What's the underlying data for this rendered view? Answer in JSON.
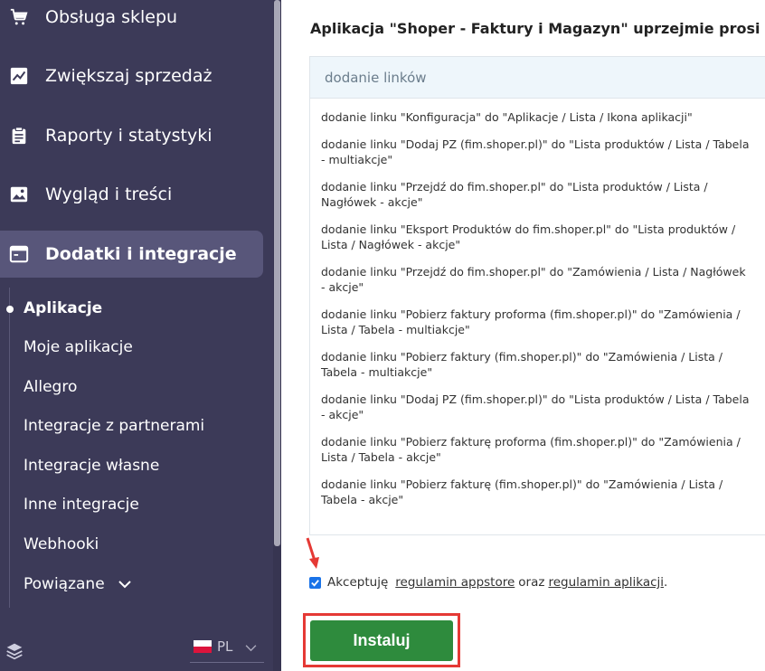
{
  "sidebar": {
    "nav": [
      {
        "label": "Obsługa sklepu",
        "icon": "cart-icon"
      },
      {
        "label": "Zwiększaj sprzedaż",
        "icon": "trend-chart-icon"
      },
      {
        "label": "Raporty i statystyki",
        "icon": "clipboard-icon"
      },
      {
        "label": "Wygląd i treści",
        "icon": "image-icon"
      },
      {
        "label": "Dodatki i integracje",
        "icon": "window-icon",
        "active": true
      }
    ],
    "subnav": [
      {
        "label": "Aplikacje",
        "active": true
      },
      {
        "label": "Moje aplikacje"
      },
      {
        "label": "Allegro"
      },
      {
        "label": "Integracje z partnerami"
      },
      {
        "label": "Integracje własne"
      },
      {
        "label": "Inne integracje"
      },
      {
        "label": "Webhooki"
      },
      {
        "label": "Powiązane"
      }
    ],
    "language": "PL"
  },
  "main": {
    "title": "Aplikacja \"Shoper - Faktury i Magazyn\" uprzejmie prosi o",
    "permissions_header": "dodanie linków",
    "permissions": [
      "dodanie linku \"Konfiguracja\" do \"Aplikacje / Lista / Ikona aplikacji\"",
      "dodanie linku \"Dodaj PZ (fim.shoper.pl)\" do \"Lista produktów / Lista / Tabela - multiakcje\"",
      "dodanie linku \"Przejdź do fim.shoper.pl\" do \"Lista produktów / Lista / Nagłówek - akcje\"",
      "dodanie linku \"Eksport Produktów do fim.shoper.pl\" do \"Lista produktów / Lista / Nagłówek - akcje\"",
      "dodanie linku \"Przejdź do fim.shoper.pl\" do \"Zamówienia / Lista / Nagłówek - akcje\"",
      "dodanie linku \"Pobierz faktury proforma (fim.shoper.pl)\" do \"Zamówienia / Lista / Tabela - multiakcje\"",
      "dodanie linku \"Pobierz faktury (fim.shoper.pl)\" do \"Zamówienia / Lista / Tabela - multiakcje\"",
      "dodanie linku \"Dodaj PZ (fim.shoper.pl)\" do \"Lista produktów / Lista / Tabela - akcje\"",
      "dodanie linku \"Pobierz fakturę proforma (fim.shoper.pl)\" do \"Zamówienia / Lista / Tabela - akcje\"",
      "dodanie linku \"Pobierz fakturę (fim.shoper.pl)\" do \"Zamówienia / Lista / Tabela - akcje\""
    ],
    "accept": {
      "prefix": "Akceptuję",
      "link1": "regulamin appstore",
      "middle": "oraz",
      "link2": "regulamin aplikacji",
      "suffix": ".",
      "checked": true
    },
    "install_label": "Instaluj"
  },
  "colors": {
    "sidebar_bg": "#3c3a58",
    "active_bg": "#58567a",
    "install_green": "#2e8b3d",
    "highlight_red": "#e53935",
    "checkbox_blue": "#1a73e8"
  }
}
